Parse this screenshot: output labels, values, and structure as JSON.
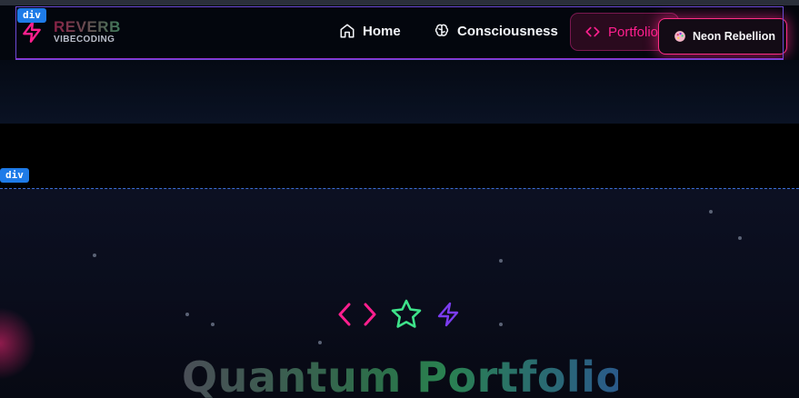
{
  "brand": {
    "title": "REVERB",
    "subtitle": "VIBECODING",
    "icon": "lightning-icon",
    "accent": "#ff1f8e"
  },
  "nav": {
    "items": [
      {
        "label": "Home",
        "icon": "home-icon"
      },
      {
        "label": "Consciousness",
        "icon": "brain-icon"
      },
      {
        "label": "Portfolio",
        "icon": "code-icon",
        "active": true
      }
    ]
  },
  "theme_button": {
    "label": "Neon Rebellion",
    "icon": "palette-icon"
  },
  "debug": {
    "nav_tag": "div",
    "hero_tag": "div"
  },
  "hero": {
    "icons": [
      "code-icon",
      "star-icon",
      "lightning-icon"
    ],
    "title": "Quantum Portfolio"
  },
  "colors": {
    "pink": "#ff1f8e",
    "green": "#3ee38a",
    "purple": "#7b3cf0",
    "outline": "#6d4bd6",
    "debug_blue": "#1e7be8"
  }
}
